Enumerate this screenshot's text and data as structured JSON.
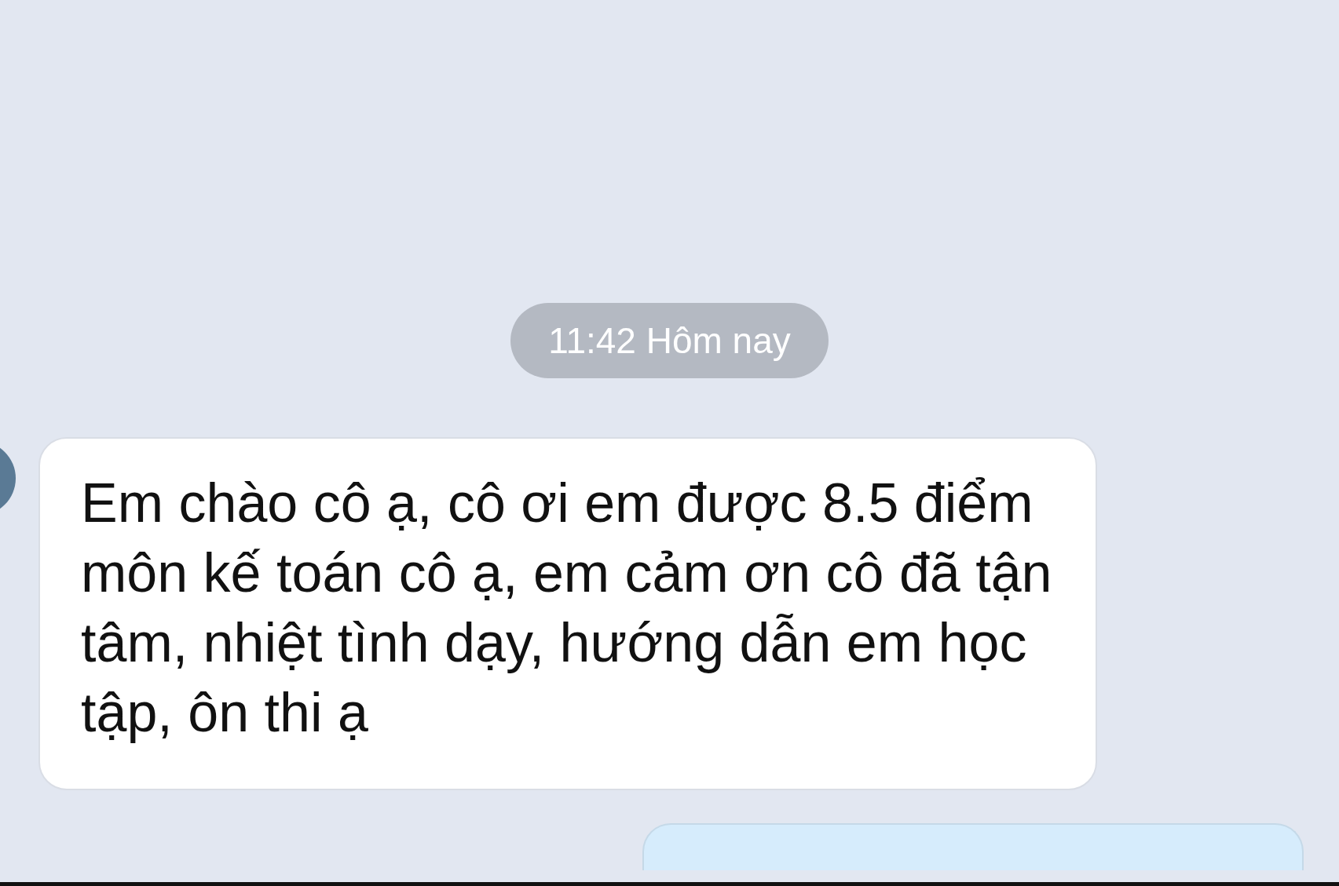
{
  "timestamp": "11:42 Hôm nay",
  "messages": [
    {
      "kind": "incoming",
      "text": "Em chào cô ạ, cô ơi em được 8.5 điểm môn kế toán cô ạ, em cảm ơn cô đã tận tâm, nhiệt tình dạy, hướng dẫn em học tập, ôn thi ạ"
    },
    {
      "kind": "outgoing"
    }
  ]
}
